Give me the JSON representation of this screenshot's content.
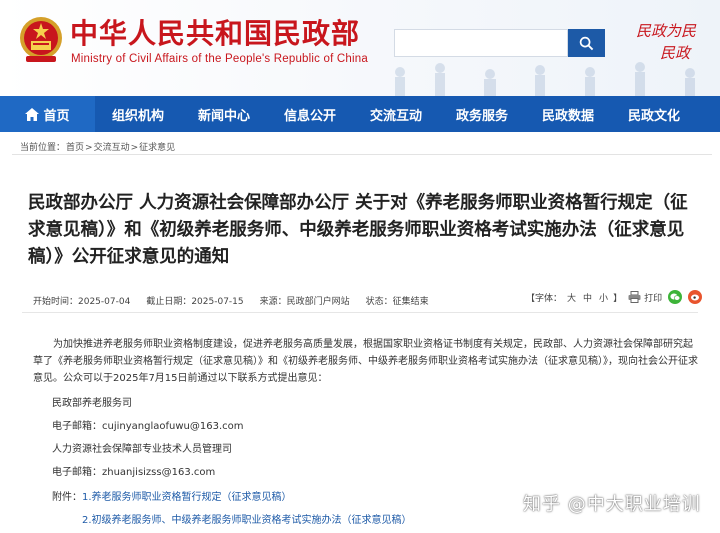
{
  "header": {
    "title": "中华人民共和国民政部",
    "subtitle": "Ministry of Civil Affairs of the People's Republic of China",
    "slogan_line1": "民政为民",
    "slogan_line2": "民政",
    "search_placeholder": ""
  },
  "nav": {
    "items": [
      {
        "label": "首页"
      },
      {
        "label": "组织机构"
      },
      {
        "label": "新闻中心"
      },
      {
        "label": "信息公开"
      },
      {
        "label": "交流互动"
      },
      {
        "label": "政务服务"
      },
      {
        "label": "民政数据"
      },
      {
        "label": "民政文化"
      }
    ]
  },
  "breadcrumb": {
    "prefix": "当前位置：",
    "items": [
      "首页",
      "交流互动",
      "征求意见"
    ],
    "separator": ">"
  },
  "article": {
    "title": "民政部办公厅 人力资源社会保障部办公厅 关于对《养老服务师职业资格暂行规定（征求意见稿）》和《初级养老服务师、中级养老服务师职业资格考试实施办法（征求意见稿）》公开征求意见的通知",
    "start_time": "开始时间：2025-07-04",
    "end_time": "截止日期：2025-07-15",
    "source": "来源：民政部门户网站",
    "status": "状态：征集结束",
    "font_label": "【字体：",
    "font_large": "大",
    "font_medium": "中",
    "font_small": "小",
    "font_close": "】",
    "print_label": "打印",
    "body": "为加快推进养老服务师职业资格制度建设，促进养老服务高质量发展，根据国家职业资格证书制度有关规定，民政部、人力资源社会保障部研究起草了《养老服务师职业资格暂行规定（征求意见稿）》和《初级养老服务师、中级养老服务师职业资格考试实施办法（征求意见稿）》，现向社会公开征求意见。公众可以于2025年7月15日前通过以下联系方式提出意见：",
    "contact1_org": "民政部养老服务司",
    "contact1_email": "电子邮箱：cujinyanglaofuwu@163.com",
    "contact2_org": "人力资源社会保障部专业技术人员管理司",
    "contact2_email": "电子邮箱：zhuanjisizss@163.com",
    "attach_label": "附件：",
    "attach1": "1.养老服务师职业资格暂行规定（征求意见稿）",
    "attach2": "2.初级养老服务师、中级养老服务师职业资格考试实施办法（征求意见稿）"
  },
  "watermark": "知乎 @中大职业培训",
  "colors": {
    "brand_red": "#c8161d",
    "nav_blue": "#1659b1",
    "link_blue": "#1d5aa7",
    "wechat_green": "#3db439",
    "weibo_orange": "#e8542d"
  },
  "icons": [
    "emblem-icon",
    "search-icon",
    "home-icon",
    "print-icon",
    "wechat-icon",
    "weibo-icon"
  ]
}
